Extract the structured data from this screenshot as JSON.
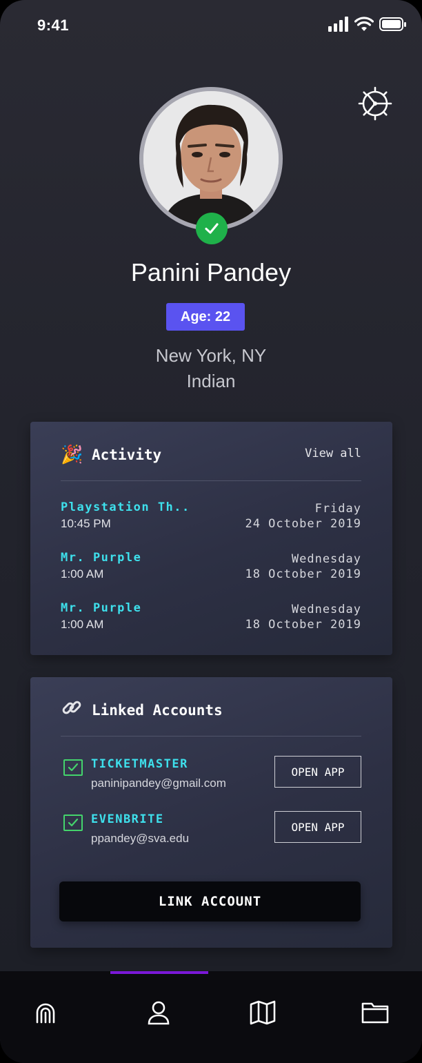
{
  "status_bar": {
    "time": "9:41"
  },
  "profile": {
    "name": "Panini Pandey",
    "age_label": "Age: 22",
    "location": "New York, NY",
    "ethnicity": "Indian",
    "verified": true
  },
  "activity": {
    "title": "Activity",
    "view_all_label": "View all",
    "items": [
      {
        "title": "Playstation Th..",
        "time": "10:45 PM",
        "day": "Friday",
        "date": "24 October 2019"
      },
      {
        "title": "Mr. Purple",
        "time": "1:00 AM",
        "day": "Wednesday",
        "date": "18 October 2019"
      },
      {
        "title": "Mr. Purple",
        "time": "1:00 AM",
        "day": "Wednesday",
        "date": "18 October 2019"
      }
    ]
  },
  "linked_accounts": {
    "title": "Linked Accounts",
    "items": [
      {
        "name": "TICKETMASTER",
        "email": "paninipandey@gmail.com",
        "button_label": "OPEN APP",
        "linked": true
      },
      {
        "name": "EVENBRITE",
        "email": "ppandey@sva.edu",
        "button_label": "OPEN APP",
        "linked": true
      }
    ],
    "link_button_label": "LINK ACCOUNT"
  },
  "bottom_nav": {
    "items": [
      "fingerprint-icon",
      "user-icon",
      "map-icon",
      "folder-icon"
    ],
    "active_index": 1
  },
  "colors": {
    "accent_cyan": "#3ee0ec",
    "age_badge": "#5a53f0",
    "verified_green": "#1fb14a",
    "check_green": "#44d46c",
    "nav_indicator": "#7b18d8"
  }
}
